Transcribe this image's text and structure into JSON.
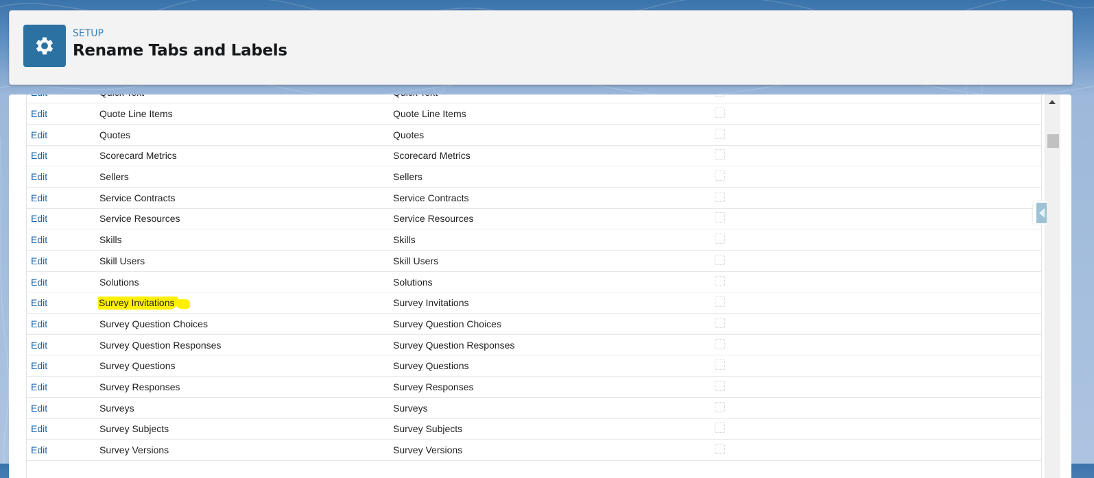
{
  "header": {
    "eyebrow": "SETUP",
    "title": "Rename Tabs and Labels",
    "icon": "gear-icon"
  },
  "table": {
    "action_label": "Edit",
    "rows": [
      {
        "name": "Quick Text",
        "plural": "Quick Text",
        "checked": false,
        "highlighted": false
      },
      {
        "name": "Quote Line Items",
        "plural": "Quote Line Items",
        "checked": false,
        "highlighted": false
      },
      {
        "name": "Quotes",
        "plural": "Quotes",
        "checked": false,
        "highlighted": false
      },
      {
        "name": "Scorecard Metrics",
        "plural": "Scorecard Metrics",
        "checked": false,
        "highlighted": false
      },
      {
        "name": "Sellers",
        "plural": "Sellers",
        "checked": false,
        "highlighted": false
      },
      {
        "name": "Service Contracts",
        "plural": "Service Contracts",
        "checked": false,
        "highlighted": false
      },
      {
        "name": "Service Resources",
        "plural": "Service Resources",
        "checked": false,
        "highlighted": false
      },
      {
        "name": "Skills",
        "plural": "Skills",
        "checked": false,
        "highlighted": false
      },
      {
        "name": "Skill Users",
        "plural": "Skill Users",
        "checked": false,
        "highlighted": false
      },
      {
        "name": "Solutions",
        "plural": "Solutions",
        "checked": false,
        "highlighted": false
      },
      {
        "name": "Survey Invitations",
        "plural": "Survey Invitations",
        "checked": false,
        "highlighted": true
      },
      {
        "name": "Survey Question Choices",
        "plural": "Survey Question Choices",
        "checked": false,
        "highlighted": false
      },
      {
        "name": "Survey Question Responses",
        "plural": "Survey Question Responses",
        "checked": false,
        "highlighted": false
      },
      {
        "name": "Survey Questions",
        "plural": "Survey Questions",
        "checked": false,
        "highlighted": false
      },
      {
        "name": "Survey Responses",
        "plural": "Survey Responses",
        "checked": false,
        "highlighted": false
      },
      {
        "name": "Surveys",
        "plural": "Surveys",
        "checked": false,
        "highlighted": false
      },
      {
        "name": "Survey Subjects",
        "plural": "Survey Subjects",
        "checked": false,
        "highlighted": false
      },
      {
        "name": "Survey Versions",
        "plural": "Survey Versions",
        "checked": false,
        "highlighted": false
      }
    ]
  },
  "colors": {
    "brand": "#2b72a2",
    "link": "#1a64a9",
    "highlight": "#fff000"
  }
}
